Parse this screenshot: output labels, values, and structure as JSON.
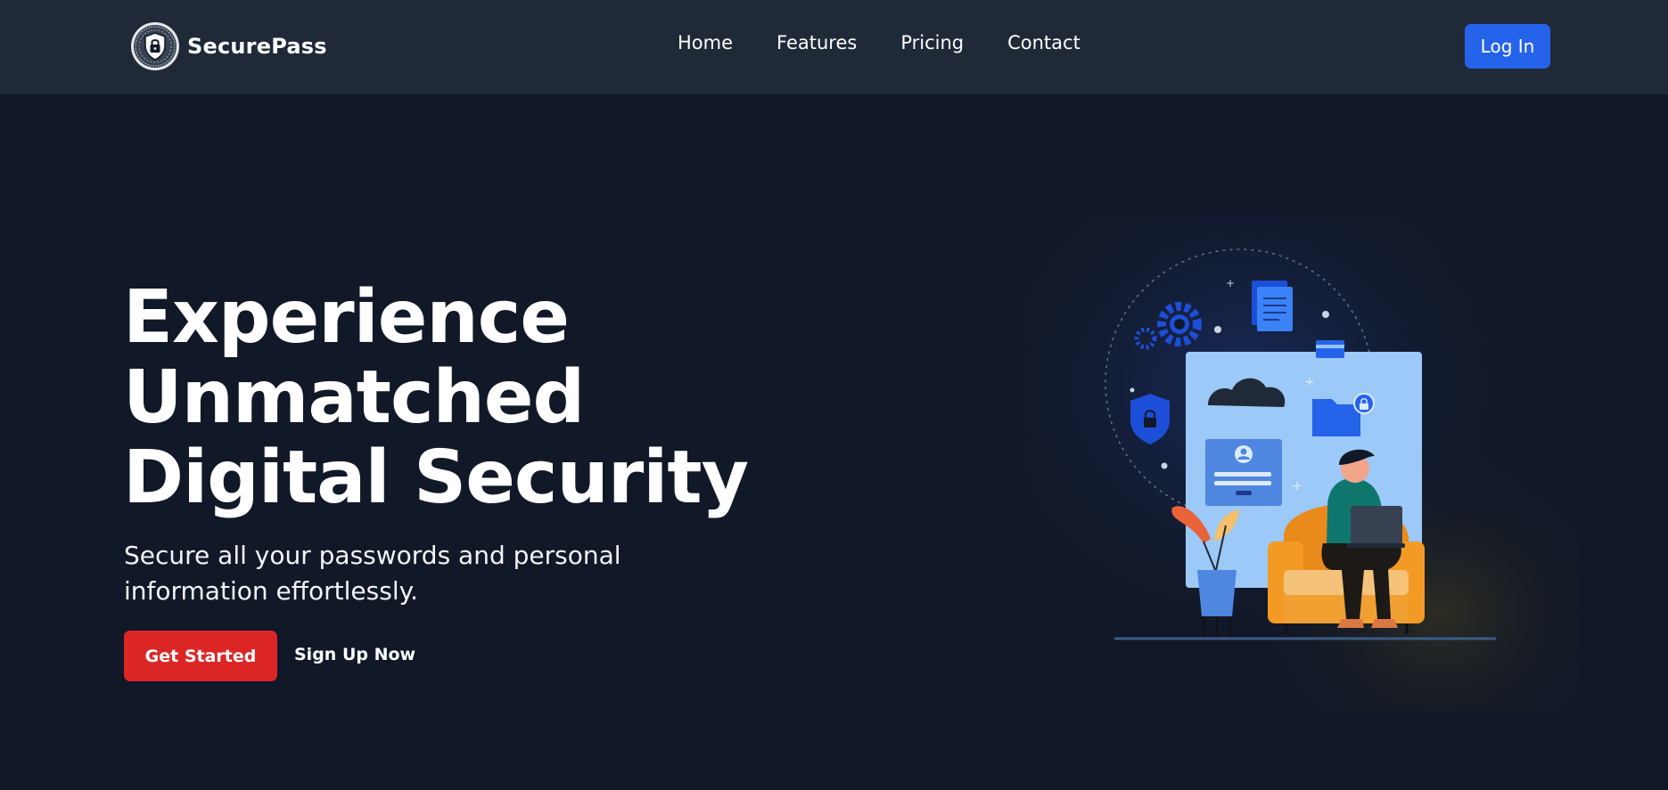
{
  "brand": {
    "name": "SecurePass",
    "logo_icon": "shield-lock-icon"
  },
  "nav": {
    "items": [
      {
        "label": "Home"
      },
      {
        "label": "Features"
      },
      {
        "label": "Pricing"
      },
      {
        "label": "Contact"
      }
    ],
    "login_label": "Log In"
  },
  "hero": {
    "title_lines": [
      "Experience",
      "Unmatched",
      "Digital Security"
    ],
    "subtitle": "Secure all your passwords and personal information effortlessly.",
    "primary_cta": "Get Started",
    "secondary_cta": "Sign Up Now",
    "illustration": "person-with-laptop-cloud-security-illustration"
  },
  "colors": {
    "navbar_bg": "#1f2937",
    "page_bg": "#111827",
    "accent_blue": "#2563eb",
    "accent_red": "#dc2626",
    "panel_blue": "#93c5fd",
    "chair_orange": "#ea8a1a"
  }
}
